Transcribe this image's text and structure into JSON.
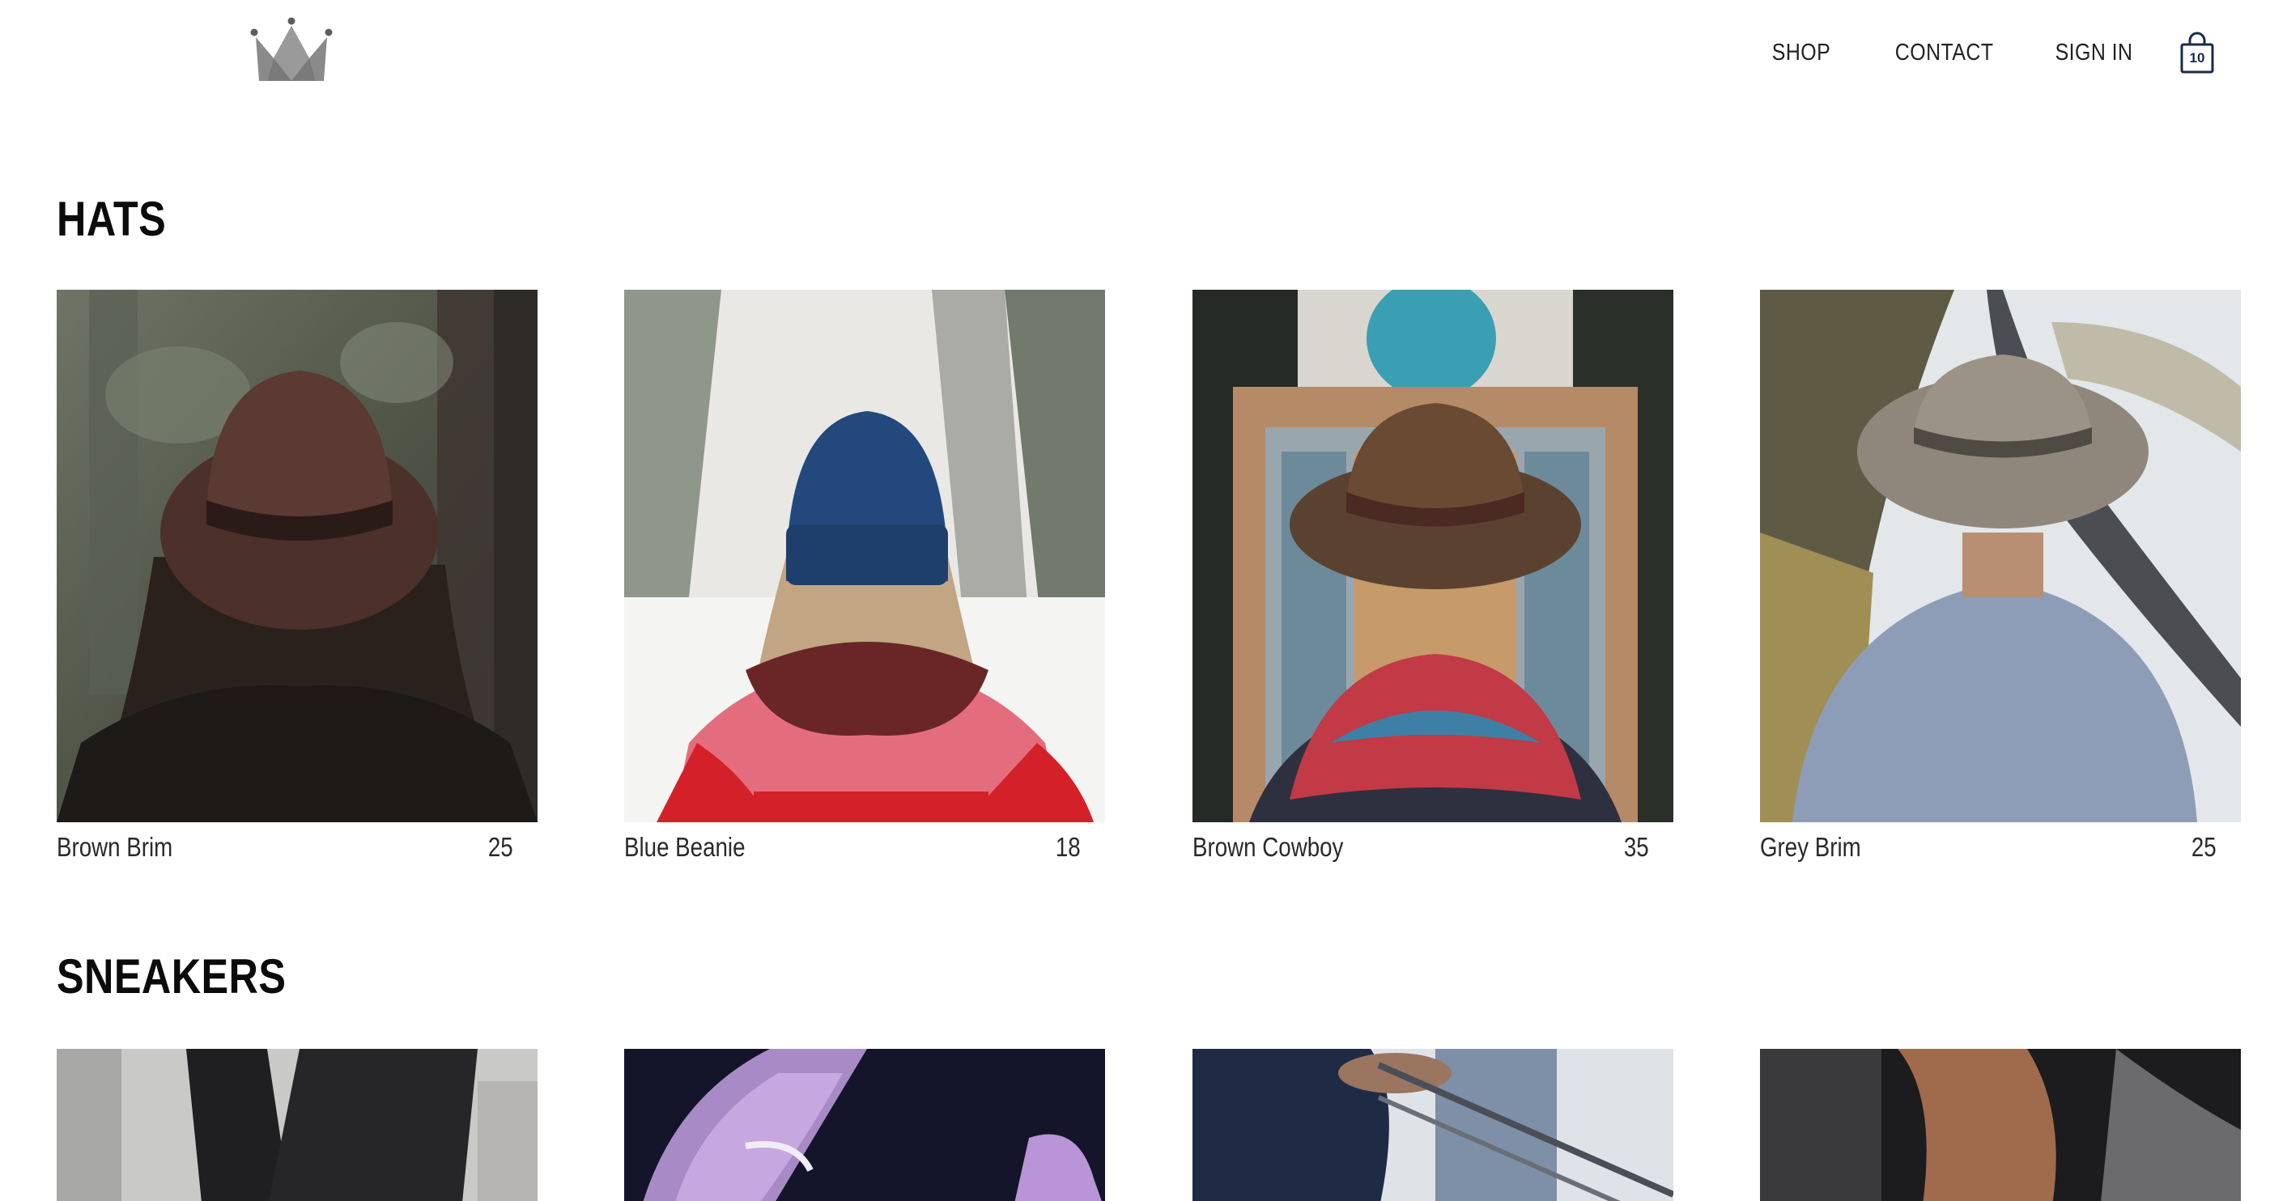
{
  "header": {
    "logo_icon": "crown-icon",
    "nav": [
      {
        "label": "SHOP"
      },
      {
        "label": "CONTACT"
      },
      {
        "label": "SIGN IN"
      }
    ],
    "cart": {
      "icon": "shopping-bag-icon",
      "count": "10"
    }
  },
  "sections": [
    {
      "title": "HATS",
      "items": [
        {
          "name": "Brown Brim",
          "price": "25"
        },
        {
          "name": "Blue Beanie",
          "price": "18"
        },
        {
          "name": "Brown Cowboy",
          "price": "35"
        },
        {
          "name": "Grey Brim",
          "price": "25"
        }
      ]
    },
    {
      "title": "SNEAKERS",
      "items": [
        {},
        {},
        {},
        {}
      ]
    }
  ],
  "colors": {
    "text": "#111111",
    "logo": "#6d6d6d",
    "cart_count": "#1a2a4a"
  }
}
